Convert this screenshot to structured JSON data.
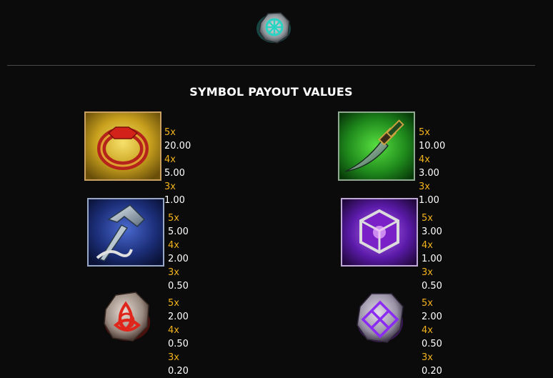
{
  "header": {
    "top_symbol_icon": "celtic-knot-stone-icon",
    "title": "SYMBOL PAYOUT VALUES"
  },
  "symbols": [
    {
      "icon": "red-gem-ring-icon",
      "pays": [
        {
          "mult": "5x",
          "val": "20.00"
        },
        {
          "mult": "4x",
          "val": "5.00"
        },
        {
          "mult": "3x",
          "val": "1.00"
        }
      ]
    },
    {
      "icon": "green-dagger-icon",
      "pays": [
        {
          "mult": "5x",
          "val": "10.00"
        },
        {
          "mult": "4x",
          "val": "3.00"
        },
        {
          "mult": "3x",
          "val": "1.00"
        }
      ]
    },
    {
      "icon": "blue-hammer-icon",
      "pays": [
        {
          "mult": "5x",
          "val": "5.00"
        },
        {
          "mult": "4x",
          "val": "2.00"
        },
        {
          "mult": "3x",
          "val": "0.50"
        }
      ]
    },
    {
      "icon": "purple-cube-icon",
      "pays": [
        {
          "mult": "5x",
          "val": "3.00"
        },
        {
          "mult": "4x",
          "val": "1.00"
        },
        {
          "mult": "3x",
          "val": "0.50"
        }
      ]
    },
    {
      "icon": "red-rune-stone-icon",
      "pays": [
        {
          "mult": "5x",
          "val": "2.00"
        },
        {
          "mult": "4x",
          "val": "0.50"
        },
        {
          "mult": "3x",
          "val": "0.20"
        }
      ]
    },
    {
      "icon": "purple-rune-stone-icon",
      "pays": [
        {
          "mult": "5x",
          "val": "2.00"
        },
        {
          "mult": "4x",
          "val": "0.50"
        },
        {
          "mult": "3x",
          "val": "0.20"
        }
      ]
    }
  ],
  "colors": {
    "background": "#0b0b0b",
    "multiplier": "#f2b21c",
    "value": "#ffffff"
  }
}
